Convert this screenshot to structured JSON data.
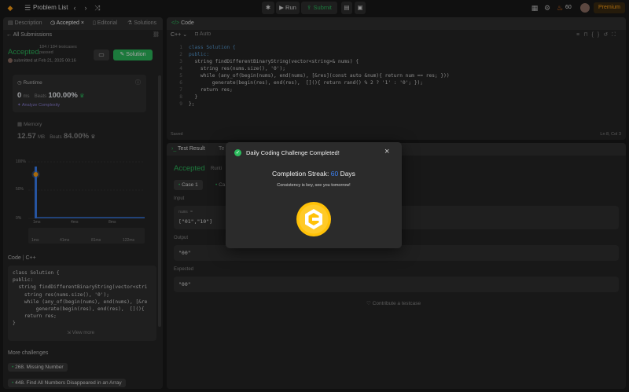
{
  "topbar": {
    "problem_list": "Problem List",
    "run": "Run",
    "submit": "Submit",
    "streak_count": "60",
    "premium": "Premium"
  },
  "left": {
    "tabs": [
      "Description",
      "Accepted",
      "Editorial",
      "Solutions"
    ],
    "all_submissions": "All Submissions",
    "accepted": "Accepted",
    "testcases": "184 / 184 testcases passed",
    "submitted": "submitted at Feb 21, 2025 00:16",
    "solution_btn": "Solution",
    "runtime_label": "Runtime",
    "runtime_value": "0",
    "runtime_unit": "ms",
    "beats_label": "Beats",
    "runtime_beats": "100.00%",
    "analyze": "Analyze Complexity",
    "memory_label": "Memory",
    "memory_value": "12.57",
    "memory_unit": "MB",
    "memory_beats": "84.00%",
    "chart_y": [
      "100%",
      "50%",
      "0%"
    ],
    "chart_x": [
      "1ms",
      "4ms",
      "8ms",
      "12ms"
    ],
    "chart_x2": [
      "1ms",
      "41ms",
      "81ms",
      "122ms"
    ],
    "code_label": "Code",
    "code_lang": "C++",
    "code_lines": [
      "class Solution {",
      "public:",
      "  string findDifferentBinaryString(vector<stri",
      "    string res(nums.size(), '0');",
      "    while (any_of(begin(nums), end(nums), [&re",
      "        generate(begin(res), end(res),  [](){",
      "    return res;",
      "}"
    ],
    "view_more": "View more",
    "more_challenges": "More challenges",
    "challenges": [
      "268. Missing Number",
      "448. Find All Numbers Disappeared in an Array"
    ]
  },
  "editor": {
    "title": "Code",
    "lang": "C++",
    "mode": "Auto",
    "lines": [
      "class Solution {",
      "public:",
      "  string findDifferentBinaryString(vector<string>& nums) {",
      "    string res(nums.size(), '0');",
      "    while (any_of(begin(nums), end(nums), [&res](const auto &num){ return num == res; }))",
      "        generate(begin(res), end(res),  [](){ return rand() % 2 ? '1' : '0'; });",
      "    return res;",
      "  }",
      "};"
    ],
    "line_numbers": [
      "1",
      "2",
      "3",
      "4",
      "5",
      "6",
      "7",
      "8",
      "9"
    ],
    "saved": "Saved",
    "cursor": "Ln 8, Col 3"
  },
  "result": {
    "tab1": "Test Result",
    "tab2": "Te",
    "accepted": "Accepted",
    "runtime": "Runti",
    "case1": "Case 1",
    "case2": "Ca",
    "input_label": "Input",
    "nums_label": "nums =",
    "input_value": "[\"01\",\"10\"]",
    "output_label": "Output",
    "output_value": "\"00\"",
    "expected_label": "Expected",
    "expected_value": "\"00\"",
    "contribute": "Contribute a testcase"
  },
  "modal": {
    "title": "Daily Coding Challenge Completed!",
    "streak_prefix": "Completion Streak:",
    "streak_value": "60",
    "streak_suffix": "Days",
    "message": "Consistency is key, see you tomorrow!"
  },
  "colors": {
    "accent_green": "#2cbb5d",
    "accent_blue": "#3b82f6",
    "coin": "#ffc107",
    "premium": "#ffa116"
  }
}
